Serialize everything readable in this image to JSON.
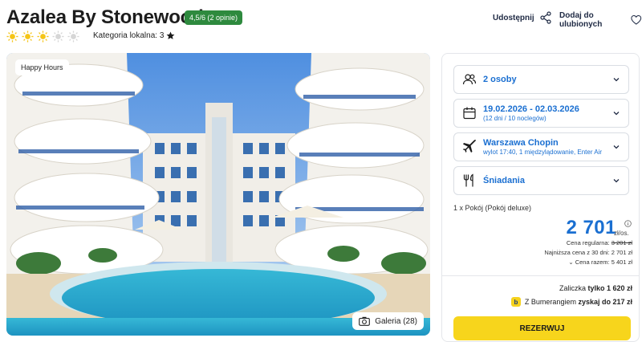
{
  "hotel": {
    "name": "Azalea By Stonewood",
    "rating_badge": "4,5/6 (2 opinie)",
    "sun_rating": 3,
    "sun_max": 5,
    "local_category": "Kategoria lokalna: 3"
  },
  "header_actions": {
    "share_label": "Udostępnij",
    "favorite_label": "Dodaj do ulubionych"
  },
  "photo": {
    "tag": "Happy Hours",
    "gallery_label": "Galeria (28)"
  },
  "booking": {
    "guests": "2 osoby",
    "dates": "19.02.2026 - 02.03.2026",
    "dates_sub": "(12 dni / 10 noclegów)",
    "airport": "Warszawa Chopin",
    "flight_sub": "wylot 17:40, 1 międzylądowanie, Enter Air",
    "board": "Śniadania",
    "room": "1 x Pokój   (Pokój deluxe)",
    "price": "2 701",
    "price_unit": "zł/os.",
    "regular_label": "Cena regularna: ",
    "regular_value": "3 201 zł",
    "lowest_30": "Najniższa cena z 30 dni: 2 701 zł",
    "total": "Cena razem: 5 401 zł",
    "deposit_prefix": "Zaliczka ",
    "deposit_value": "tylko 1 620 zł",
    "boomerang_prefix": "Z Bumerangiem ",
    "boomerang_value": "zyskaj do 217 zł",
    "boomerang_badge": "b",
    "reserve_label": "REZERWUJ"
  },
  "colors": {
    "accent_blue": "#1a6fd1",
    "rating_green": "#2e8a3e",
    "sun_yellow": "#f5c518",
    "reserve_yellow": "#f7d51c"
  }
}
